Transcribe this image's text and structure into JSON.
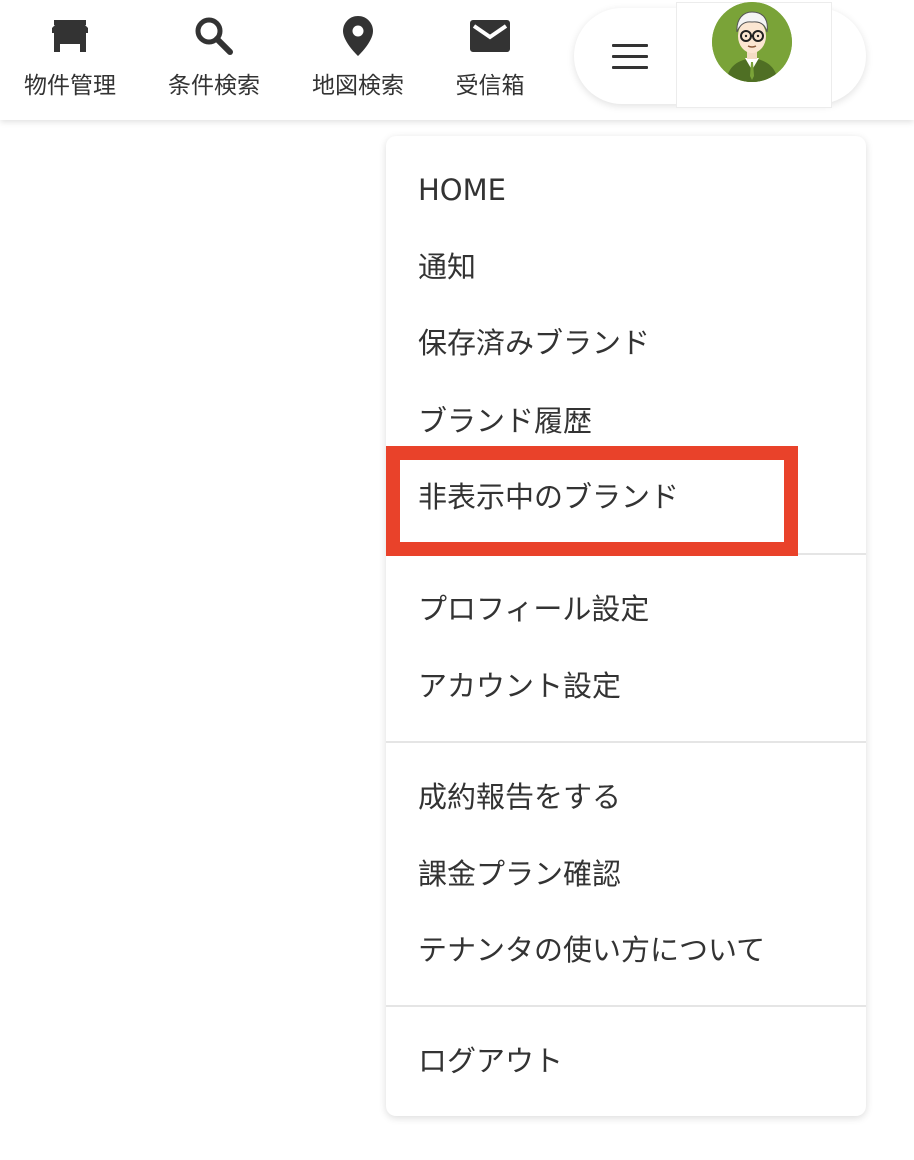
{
  "topnav": {
    "items": [
      {
        "label": "物件管理",
        "icon": "store-icon"
      },
      {
        "label": "条件検索",
        "icon": "search-icon"
      },
      {
        "label": "地図検索",
        "icon": "map-pin-icon"
      },
      {
        "label": "受信箱",
        "icon": "mail-icon"
      }
    ],
    "menu_icon": "hamburger-menu-icon",
    "avatar_icon": "user-avatar"
  },
  "menu": {
    "sections": [
      [
        "HOME",
        "通知",
        "保存済みブランド",
        "ブランド履歴",
        "非表示中のブランド"
      ],
      [
        "プロフィール設定",
        "アカウント設定"
      ],
      [
        "成約報告をする",
        "課金プラン確認",
        "テナンタの使い方について"
      ],
      [
        "ログアウト"
      ]
    ],
    "highlighted_item": "非表示中のブランド"
  },
  "colors": {
    "highlight_border": "#e9422a",
    "avatar_bg": "#7aa338",
    "text": "#333333"
  }
}
